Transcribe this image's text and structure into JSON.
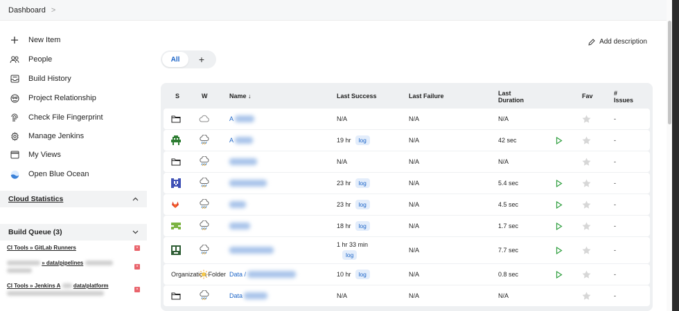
{
  "breadcrumb": {
    "root": "Dashboard",
    "chevron": ">"
  },
  "sidebar": {
    "items": [
      {
        "label": "New Item",
        "icon": "plus-icon"
      },
      {
        "label": "People",
        "icon": "people-icon"
      },
      {
        "label": "Build History",
        "icon": "inbox-icon"
      },
      {
        "label": "Project Relationship",
        "icon": "relationship-icon"
      },
      {
        "label": "Check File Fingerprint",
        "icon": "fingerprint-icon"
      },
      {
        "label": "Manage Jenkins",
        "icon": "gear-icon"
      },
      {
        "label": "My Views",
        "icon": "window-icon"
      },
      {
        "label": "Open Blue Ocean",
        "icon": "blue-ocean-icon"
      }
    ],
    "cloud_statistics": "Cloud Statistics",
    "build_queue": {
      "title": "Build Queue (3)",
      "items": [
        {
          "text": "CI Tools » GitLab Runners"
        },
        {
          "text": "» data/pipelines"
        },
        {
          "text": "CI Tools » Jenkins A",
          "text2": "data/platform"
        }
      ]
    }
  },
  "actions": {
    "add_description": "Add description"
  },
  "view_tabs": {
    "all": "All",
    "plus": "+"
  },
  "table": {
    "columns": {
      "s": "S",
      "w": "W",
      "name": "Name ↓",
      "last_success": "Last Success",
      "last_failure": "Last Failure",
      "last_duration_1": "Last",
      "last_duration_2": "Duration",
      "fav": "Fav",
      "issues_1": "#",
      "issues_2": "Issues"
    },
    "rows": [
      {
        "status": "folder",
        "weather": "cloudy",
        "prefix": "",
        "name": "A",
        "last_success": "N/A",
        "log": "",
        "last_failure": "N/A",
        "duration": "N/A",
        "play": false,
        "issues": "-"
      },
      {
        "status": "pixel-green-avatar",
        "weather": "rain",
        "prefix": "",
        "name": "A",
        "last_success": "19 hr",
        "log": "log",
        "last_failure": "N/A",
        "duration": "42 sec",
        "play": true,
        "issues": "-"
      },
      {
        "status": "folder",
        "weather": "rain",
        "prefix": "",
        "name": "",
        "last_success": "N/A",
        "log": "",
        "last_failure": "N/A",
        "duration": "N/A",
        "play": false,
        "issues": "-"
      },
      {
        "status": "pixel-blue-avatar",
        "weather": "rain",
        "prefix": "",
        "name": "",
        "last_success": "23 hr",
        "log": "log",
        "last_failure": "N/A",
        "duration": "5.4 sec",
        "play": true,
        "issues": "-"
      },
      {
        "status": "gitlab-icon",
        "weather": "rain",
        "prefix": "",
        "name": "",
        "last_success": "23 hr",
        "log": "log",
        "last_failure": "N/A",
        "duration": "4.5 sec",
        "play": true,
        "issues": "-"
      },
      {
        "status": "pixel-lightgreen-avatar",
        "weather": "rain",
        "prefix": "",
        "name": "",
        "last_success": "18 hr",
        "log": "log",
        "last_failure": "N/A",
        "duration": "1.7 sec",
        "play": true,
        "issues": "-"
      },
      {
        "status": "pixel-darkgreen-avatar",
        "weather": "rain",
        "prefix": "",
        "name": "",
        "last_success": "1 hr 33 min",
        "log": "log",
        "last_failure": "N/A",
        "duration": "7.7 sec",
        "play": true,
        "issues": "-"
      },
      {
        "status": "",
        "weather": "sunny",
        "prefix": "Organization Folder",
        "name": "Data /",
        "last_success": "10 hr",
        "log": "log",
        "last_failure": "N/A",
        "duration": "0.8 sec",
        "play": true,
        "issues": "-"
      },
      {
        "status": "folder",
        "weather": "rain",
        "prefix": "",
        "name": "Data",
        "last_success": "N/A",
        "log": "",
        "last_failure": "N/A",
        "duration": "N/A",
        "play": false,
        "issues": "-"
      }
    ]
  },
  "colors": {
    "accent": "#1b64c7",
    "play": "#2e9e3e",
    "star": "#d7d7d7",
    "queue_x": "#e9636b"
  }
}
